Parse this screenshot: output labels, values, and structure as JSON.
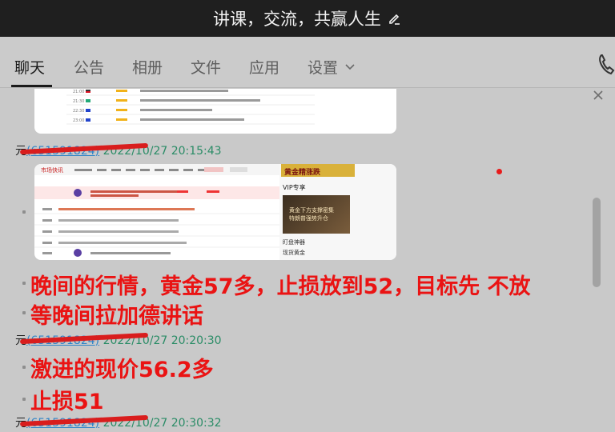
{
  "window": {
    "title": "讲课，交流，共赢人生"
  },
  "tabs": [
    "聊天",
    "公告",
    "相册",
    "文件",
    "应用",
    "设置"
  ],
  "chat": {
    "shot2_texts": {
      "brand": "市场快讯",
      "banner": "黄金精涨跌",
      "vip_header": "VIP专享",
      "vip_card_line1": "黄金下方支撑密集",
      "vip_card_line2": "特朗普强势升仓",
      "side_label": "盯盘神器",
      "side_label2": "现货黄金"
    },
    "messages": [
      {
        "sender_name": "元",
        "sender_id": "651591824",
        "time": "2022/10/27 20:15:43"
      },
      {
        "lines": [
          "晚间的行情，黄金57多，止损放到52，目标先 不放",
          "等晚间拉加德讲话"
        ]
      },
      {
        "sender_name": "元",
        "sender_id": "651591824",
        "time": "2022/10/27 20:20:30"
      },
      {
        "lines": [
          "激进的现价56.2多",
          "止损51"
        ]
      },
      {
        "sender_name": "元",
        "sender_id": "651591824",
        "time": "2022/10/27 20:30:32"
      }
    ]
  },
  "colors": {
    "title_bg": "#1f1f1f",
    "chat_bg": "#c9c9c9",
    "message_red": "#ea1313",
    "time_green": "#2a8c66",
    "id_blue": "#2f84c8"
  },
  "icons": [
    "edit-icon",
    "chevron-down-icon",
    "phone-icon",
    "close-icon"
  ]
}
